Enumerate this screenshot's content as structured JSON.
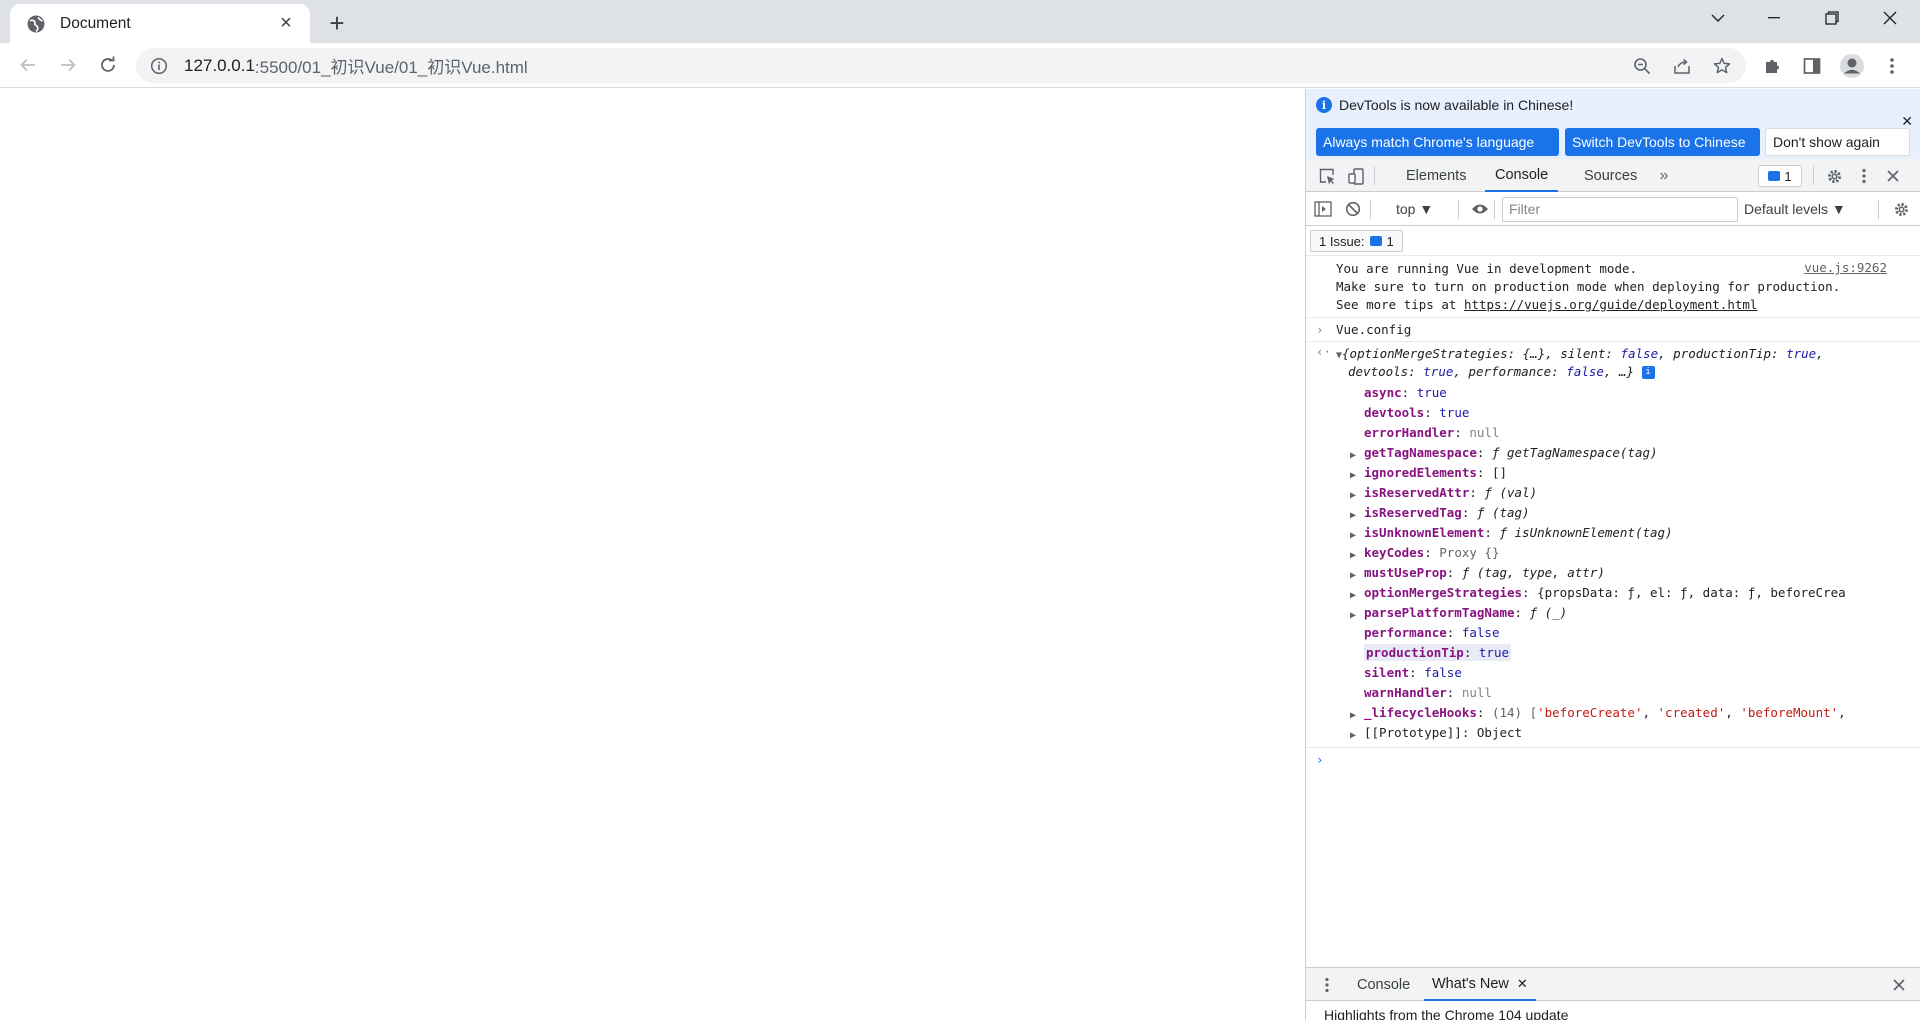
{
  "browser": {
    "tab_title": "Document",
    "url_host": "127.0.0.1",
    "url_path": ":5500/01_初识Vue/01_初识Vue.html"
  },
  "devtools": {
    "infobar": {
      "message": "DevTools is now available in Chinese!",
      "btn_match": "Always match Chrome's language",
      "btn_switch": "Switch DevTools to Chinese",
      "btn_dont_show": "Don't show again"
    },
    "tabs": [
      "Elements",
      "Console",
      "Sources"
    ],
    "issue_count": "1",
    "filter": {
      "context": "top",
      "placeholder": "Filter",
      "levels": "Default levels"
    },
    "issues_label": "1 Issue:",
    "issues_count": "1",
    "console": {
      "dev_msg_1": "You are running Vue in development mode.",
      "dev_msg_2": "Make sure to turn on production mode when deploying for production.",
      "dev_msg_3_prefix": "See more tips at ",
      "dev_msg_3_link": "https://vuejs.org/guide/deployment.html",
      "dev_msg_source": "vue.js:9262",
      "input": "Vue.config",
      "summary_1": "{optionMergeStrategies: {…}, silent: false, productionTip: true,",
      "summary_2": "devtools: true, performance: false, …}",
      "props": [
        {
          "key": "async",
          "sep": ": ",
          "val": "true",
          "kind": "kw",
          "expandable": false
        },
        {
          "key": "devtools",
          "sep": ": ",
          "val": "true",
          "kind": "kw",
          "expandable": false
        },
        {
          "key": "errorHandler",
          "sep": ": ",
          "val": "null",
          "kind": "nul",
          "expandable": false
        },
        {
          "key": "getTagNamespace",
          "sep": ": ",
          "val": "ƒ getTagNamespace(tag)",
          "kind": "it",
          "expandable": true
        },
        {
          "key": "ignoredElements",
          "sep": ": ",
          "val": "[]",
          "kind": "plain",
          "expandable": true
        },
        {
          "key": "isReservedAttr",
          "sep": ": ",
          "val": "ƒ (val)",
          "kind": "it",
          "expandable": true
        },
        {
          "key": "isReservedTag",
          "sep": ": ",
          "val": "ƒ (tag)",
          "kind": "it",
          "expandable": true
        },
        {
          "key": "isUnknownElement",
          "sep": ": ",
          "val": "ƒ isUnknownElement(tag)",
          "kind": "it",
          "expandable": true
        },
        {
          "key": "keyCodes",
          "sep": ": ",
          "val": "Proxy {}",
          "kind": "gray",
          "expandable": true
        },
        {
          "key": "mustUseProp",
          "sep": ": ",
          "val": "ƒ (tag, type, attr)",
          "kind": "it",
          "expandable": true
        },
        {
          "key": "optionMergeStrategies",
          "sep": ": ",
          "val": "{propsData: ƒ, el: ƒ, data: ƒ, beforeCrea",
          "kind": "plain",
          "expandable": true
        },
        {
          "key": "parsePlatformTagName",
          "sep": ": ",
          "val": "ƒ (_)",
          "kind": "it",
          "expandable": true
        },
        {
          "key": "performance",
          "sep": ": ",
          "val": "false",
          "kind": "kw",
          "expandable": false
        },
        {
          "key": "productionTip",
          "sep": ": ",
          "val": "true",
          "kind": "kw",
          "expandable": false,
          "highlight": true
        },
        {
          "key": "silent",
          "sep": ": ",
          "val": "false",
          "kind": "kw",
          "expandable": false
        },
        {
          "key": "warnHandler",
          "sep": ": ",
          "val": "null",
          "kind": "nul",
          "expandable": false
        },
        {
          "key": "_lifecycleHooks",
          "sep": ": ",
          "val": "(14) ['beforeCreate', 'created', 'beforeMount',",
          "kind": "arr",
          "expandable": true
        },
        {
          "key": "[[Prototype]]",
          "sep": ": ",
          "val": "Object",
          "kind": "proto",
          "expandable": true
        }
      ]
    },
    "drawer": {
      "tab_console": "Console",
      "tab_whatsnew": "What's New",
      "highlights": "Highlights from the Chrome 104 update"
    }
  },
  "colors": {
    "accent": "#1a73e8",
    "key": "#881280",
    "keyword": "#1a1aa6",
    "string": "#c41a16"
  }
}
